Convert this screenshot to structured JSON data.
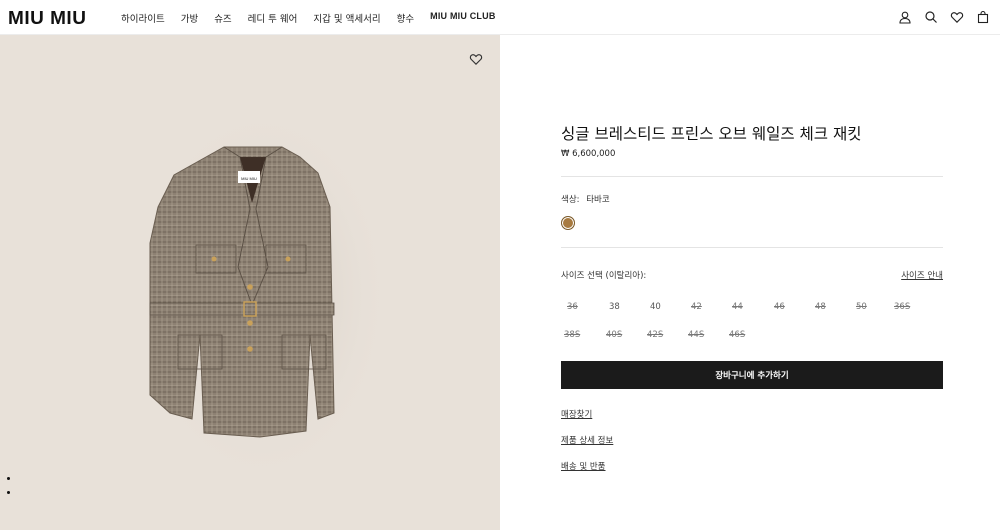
{
  "header": {
    "logo": "MIU MIU",
    "nav": [
      "하이라이트",
      "가방",
      "슈즈",
      "레디 투 웨어",
      "지갑 및 액세서리",
      "향수",
      "MIU MIU CLUB"
    ]
  },
  "icons": [
    "user-icon",
    "search-icon",
    "heart-icon",
    "bag-icon"
  ],
  "product": {
    "title": "싱글 브레스티드 프린스 오브 웨일즈 체크 재킷",
    "price": "₩ 6,600,000",
    "color_label": "색상:",
    "color_value": "타바코",
    "color_hex": "#a87a3f",
    "size_label": "사이즈 선택 (이탈리아):",
    "size_guide": "사이즈 안내",
    "sizes": [
      {
        "label": "36",
        "available": false
      },
      {
        "label": "38",
        "available": true
      },
      {
        "label": "40",
        "available": true
      },
      {
        "label": "42",
        "available": false
      },
      {
        "label": "44",
        "available": false
      },
      {
        "label": "46",
        "available": false
      },
      {
        "label": "48",
        "available": false
      },
      {
        "label": "50",
        "available": false
      },
      {
        "label": "36S",
        "available": false
      },
      {
        "label": "38S",
        "available": false
      },
      {
        "label": "40S",
        "available": false
      },
      {
        "label": "42S",
        "available": false
      },
      {
        "label": "44S",
        "available": false
      },
      {
        "label": "46S",
        "available": false
      }
    ],
    "add_to_cart": "장바구니에 추가하기",
    "links": [
      "매장찾기",
      "제품 상세 정보",
      "배송 및 반품"
    ]
  }
}
